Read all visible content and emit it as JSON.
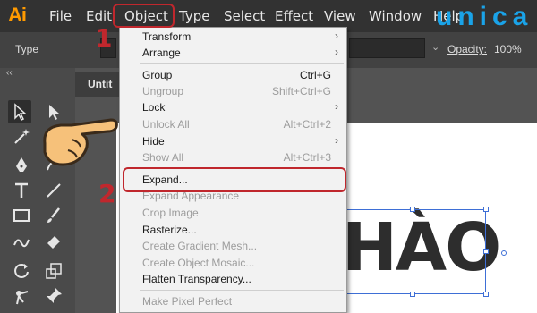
{
  "app": {
    "logo": "Ai"
  },
  "menubar": {
    "items": [
      "File",
      "Edit",
      "Object",
      "Type",
      "Select",
      "Effect",
      "View",
      "Window",
      "Help"
    ]
  },
  "controlbar": {
    "type_label": "Type",
    "opacity_label": "Opacity:",
    "opacity_value": "100%"
  },
  "document": {
    "tab_title": "Untit",
    "artwork_text": "HÀO"
  },
  "watermark": {
    "text": "unica"
  },
  "object_menu": {
    "items": [
      {
        "label": "Transform",
        "shortcut": "",
        "submenu": true,
        "enabled": true
      },
      {
        "label": "Arrange",
        "shortcut": "",
        "submenu": true,
        "enabled": true
      },
      {
        "label": "Group",
        "shortcut": "Ctrl+G",
        "submenu": false,
        "enabled": true
      },
      {
        "label": "Ungroup",
        "shortcut": "Shift+Ctrl+G",
        "submenu": false,
        "enabled": false
      },
      {
        "label": "Lock",
        "shortcut": "",
        "submenu": true,
        "enabled": true
      },
      {
        "label": "Unlock All",
        "shortcut": "Alt+Ctrl+2",
        "submenu": false,
        "enabled": false
      },
      {
        "label": "Hide",
        "shortcut": "",
        "submenu": true,
        "enabled": true
      },
      {
        "label": "Show All",
        "shortcut": "Alt+Ctrl+3",
        "submenu": false,
        "enabled": false
      },
      {
        "label": "Expand...",
        "shortcut": "",
        "submenu": false,
        "enabled": true
      },
      {
        "label": "Expand Appearance",
        "shortcut": "",
        "submenu": false,
        "enabled": false
      },
      {
        "label": "Crop Image",
        "shortcut": "",
        "submenu": false,
        "enabled": false
      },
      {
        "label": "Rasterize...",
        "shortcut": "",
        "submenu": false,
        "enabled": true
      },
      {
        "label": "Create Gradient Mesh...",
        "shortcut": "",
        "submenu": false,
        "enabled": false
      },
      {
        "label": "Create Object Mosaic...",
        "shortcut": "",
        "submenu": false,
        "enabled": false
      },
      {
        "label": "Flatten Transparency...",
        "shortcut": "",
        "submenu": false,
        "enabled": true
      },
      {
        "label": "Make Pixel Perfect",
        "shortcut": "",
        "submenu": false,
        "enabled": false
      }
    ]
  },
  "annotations": {
    "step1": "1",
    "step2": "2"
  },
  "toolbar": {
    "collapse_glyph": "‹‹",
    "tools": [
      "selection-tool",
      "direct-selection-tool",
      "magic-wand-tool",
      "lasso-tool",
      "pen-tool",
      "curvature-tool",
      "type-tool",
      "line-tool",
      "rectangle-tool",
      "paintbrush-tool",
      "shaper-tool",
      "eraser-tool",
      "rotate-tool",
      "scale-tool",
      "puppet-warp-tool",
      "pin-tool"
    ]
  },
  "colors": {
    "annotation_red": "#c0272d",
    "illustrator_orange": "#ff9a00",
    "selection_blue": "#3e6fd6"
  }
}
